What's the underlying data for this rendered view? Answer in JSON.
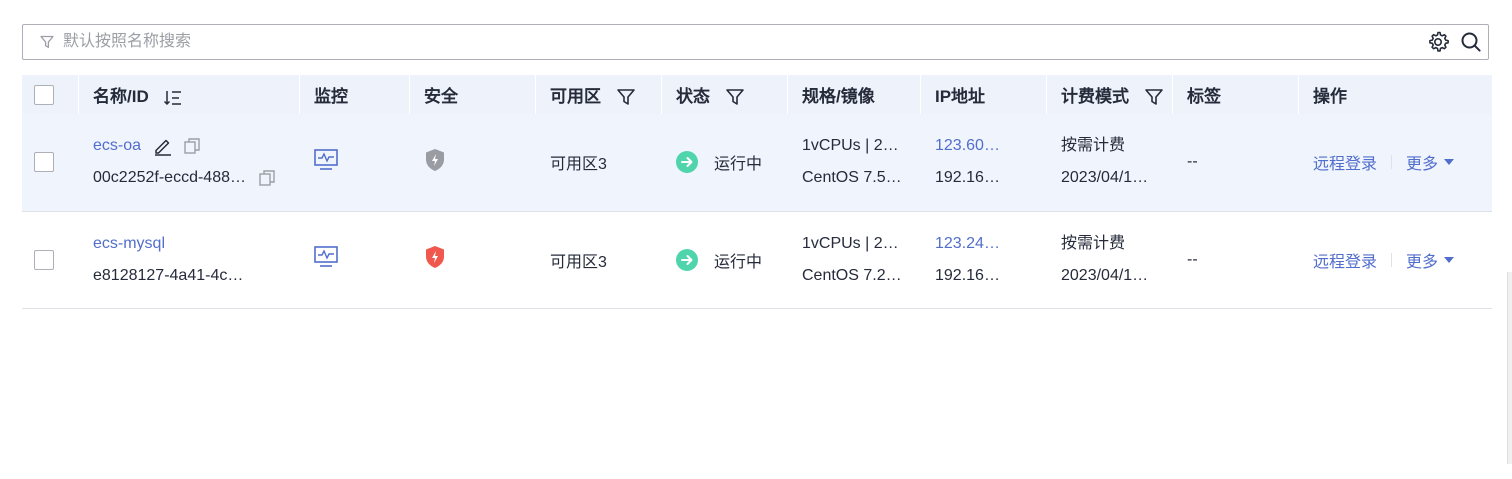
{
  "search": {
    "placeholder": "默认按照名称搜索"
  },
  "table": {
    "headers": {
      "name": "名称/ID",
      "monitor": "监控",
      "security": "安全",
      "zone": "可用区",
      "status": "状态",
      "spec": "规格/镜像",
      "ip": "IP地址",
      "billing": "计费模式",
      "tags": "标签",
      "actions": "操作"
    },
    "rows": [
      {
        "name": "ecs-oa",
        "id": "00c2252f-eccd-488…",
        "zone": "可用区3",
        "status": "运行中",
        "spec": "1vCPUs | 2…",
        "image": "CentOS 7.5…",
        "ip_public": "123.60…",
        "ip_private": "192.16…",
        "billing": "按需计费",
        "billing_date": "2023/04/1…",
        "tags": "--",
        "login": "远程登录",
        "more": "更多",
        "security_color": "#9a9ca3"
      },
      {
        "name": "ecs-mysql",
        "id": "e8128127-4a41-4c…",
        "zone": "可用区3",
        "status": "运行中",
        "spec": "1vCPUs | 2…",
        "image": "CentOS 7.2…",
        "ip_public": "123.24…",
        "ip_private": "192.16…",
        "billing": "按需计费",
        "billing_date": "2023/04/1…",
        "tags": "--",
        "login": "远程登录",
        "more": "更多",
        "security_color": "#f0574d"
      }
    ]
  },
  "icons": {
    "filter": "filter-icon",
    "settings": "gear-icon",
    "search": "search-icon",
    "sort": "sort-icon",
    "edit": "edit-icon",
    "copy": "copy-icon",
    "monitor": "monitor-icon",
    "security": "shield-icon",
    "status": "arrow-circle-icon",
    "more": "caret-down-icon"
  },
  "colors": {
    "link": "#526ecc",
    "running": "#50d4ab",
    "header_bg": "#eef2fa",
    "selected_row_bg": "#f0f4fc"
  }
}
